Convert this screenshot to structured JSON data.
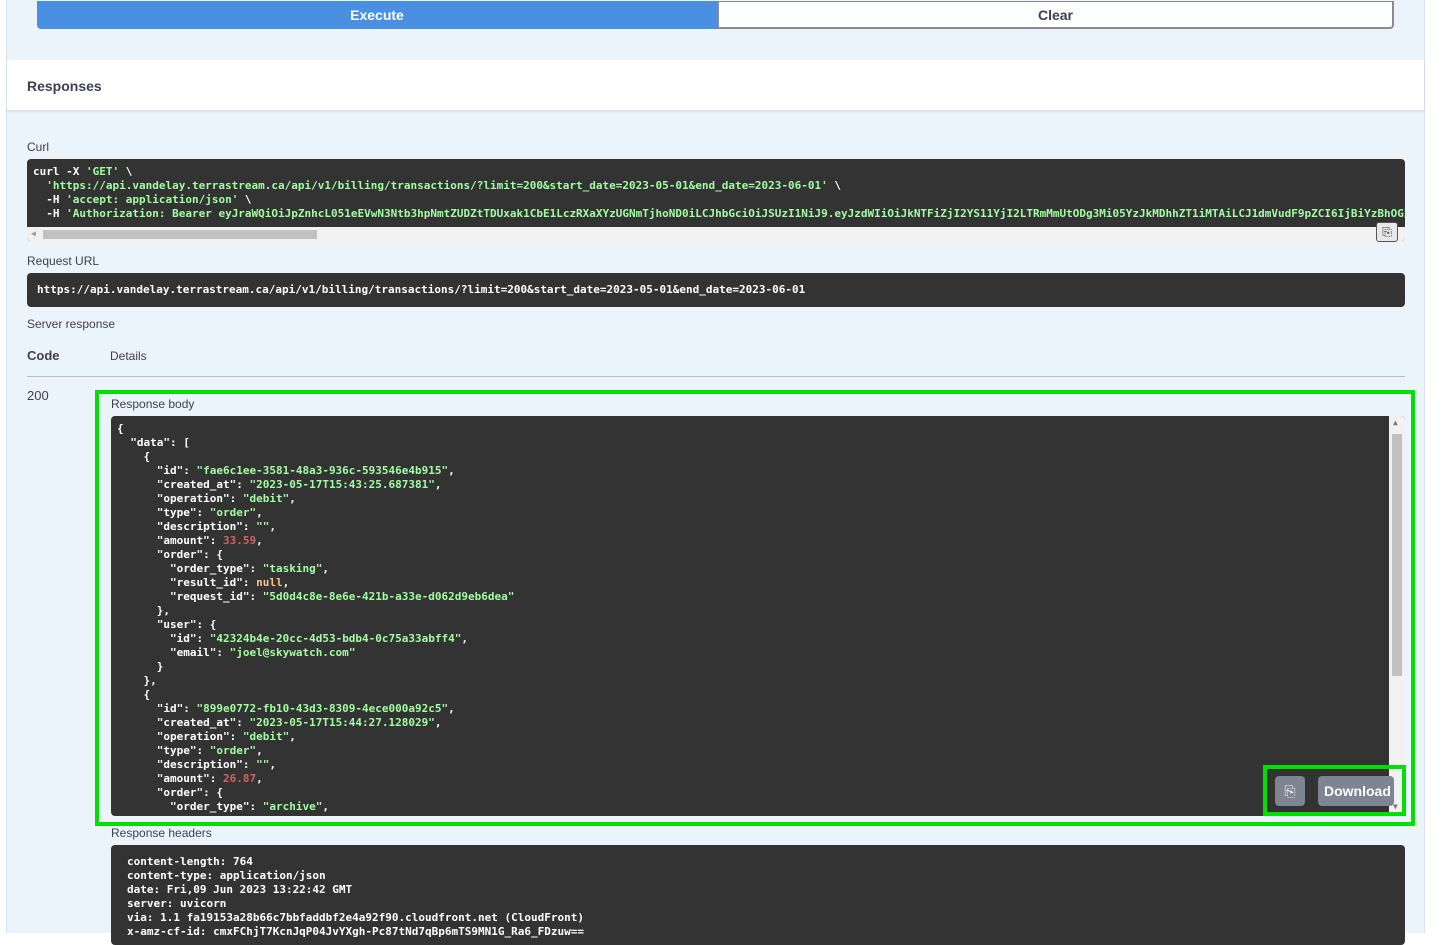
{
  "buttons": {
    "execute": "Execute",
    "clear": "Clear",
    "download": "Download"
  },
  "responses_title": "Responses",
  "labels": {
    "curl": "Curl",
    "request_url": "Request URL",
    "server_response": "Server response",
    "code": "Code",
    "details": "Details",
    "response_body": "Response body",
    "response_headers": "Response headers"
  },
  "curl_lines": [
    "curl -X 'GET' \\",
    "  'https://api.vandelay.terrastream.ca/api/v1/billing/transactions/?limit=200&start_date=2023-05-01&end_date=2023-06-01' \\",
    "  -H 'accept: application/json' \\",
    "  -H 'Authorization: Bearer eyJraWQiOiJpZnhcL051eEVwN3Ntb3hpNmtZUDZtTDUxak1CbE1LczRXaXYzUGNmTjhoND0iLCJhbGciOiJSUzI1NiJ9.eyJzdWIiOiJkNTFiZjI2YS11YjI2LTRmMmUtODg3Mi05YzJkMDhhZT1iMTAiLCJ1dmVudF9pZCI6IjBiYzBhOGI"
  ],
  "request_url": "https://api.vandelay.terrastream.ca/api/v1/billing/transactions/?limit=200&start_date=2023-05-01&end_date=2023-06-01",
  "response_code": "200",
  "transactions": [
    {
      "id": "fae6c1ee-3581-48a3-936c-593546e4b915",
      "created_at": "2023-05-17T15:43:25.687381",
      "operation": "debit",
      "type": "order",
      "description": "",
      "amount": "33.59",
      "order_type": "tasking",
      "result_id": "null",
      "request_id": "5d0d4c8e-8e6e-421b-a33e-d062d9eb6dea",
      "user_id": "42324b4e-20cc-4d53-bdb4-0c75a33abff4",
      "user_email": "joel@skywatch.com"
    },
    {
      "id": "899e0772-fb10-43d3-8309-4ece000a92c5",
      "created_at": "2023-05-17T15:44:27.128029",
      "operation": "debit",
      "type": "order",
      "description": "",
      "amount": "26.87",
      "order_type": "archive"
    }
  ],
  "response_headers": [
    "content-length: 764",
    "content-type: application/json",
    "date: Fri,09 Jun 2023 13:22:42 GMT",
    "server: uvicorn",
    "via: 1.1 fa19153a28b66c7bbfaddbf2e4a92f90.cloudfront.net (CloudFront)",
    "x-amz-cf-id: cmxFChjT7KcnJqP04JvYXgh-Pc87tNd7qBp6mTS9MN1G_Ra6_FDzuw=="
  ]
}
